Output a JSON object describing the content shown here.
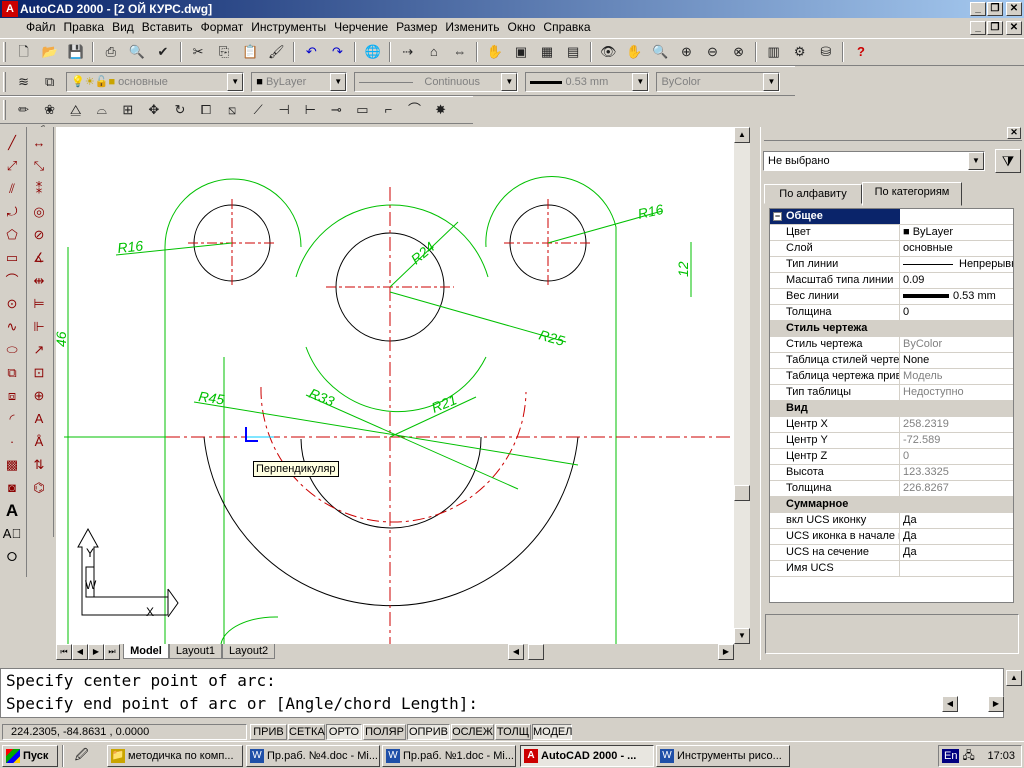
{
  "window": {
    "title": "AutoCAD 2000 - [2 ОЙ КУРС.dwg]",
    "controls": [
      "_",
      "❐",
      "✕"
    ]
  },
  "menu": [
    "Файл",
    "Правка",
    "Вид",
    "Вставить",
    "Формат",
    "Инструменты",
    "Черчение",
    "Размер",
    "Изменить",
    "Окно",
    "Справка"
  ],
  "layers_toolbar": {
    "layer": "основные",
    "color": "ByLayer",
    "linetype": "Continuous",
    "lineweight": "0.53 mm",
    "plotstyle": "ByColor"
  },
  "drawing": {
    "dimensions": [
      "R16",
      "R16",
      "R24",
      "R25",
      "R45",
      "R33",
      "R21",
      "12",
      "46"
    ],
    "tooltip": "Перпендикуляр",
    "ucs": {
      "y": "Y",
      "x": "X",
      "w": "W"
    }
  },
  "layout_tabs": [
    "Model",
    "Layout1",
    "Layout2"
  ],
  "properties": {
    "selection": "Не выбрано",
    "tabs": [
      "По алфавиту",
      "По категориям"
    ],
    "rows": [
      {
        "k": "Общее",
        "v": "",
        "cat": true,
        "sel": true
      },
      {
        "k": "Цвет",
        "v": "ByLayer",
        "swatch": true
      },
      {
        "k": "Слой",
        "v": "основные"
      },
      {
        "k": "Тип линии",
        "v": "Непрерывн",
        "line": true
      },
      {
        "k": "Масштаб типа линии",
        "v": "0.09"
      },
      {
        "k": "Вес линии",
        "v": "0.53 mm",
        "bar": true
      },
      {
        "k": "Толщина",
        "v": "0"
      },
      {
        "k": "Стиль чертежа",
        "v": "",
        "cat": true
      },
      {
        "k": "Стиль чертежа",
        "v": "ByColor",
        "grey": true
      },
      {
        "k": "Таблица стилей черте",
        "v": "None"
      },
      {
        "k": "Таблица чертежа прив",
        "v": "Модель",
        "grey": true
      },
      {
        "k": "Тип таблицы",
        "v": "Недоступно",
        "grey": true
      },
      {
        "k": "Вид",
        "v": "",
        "cat": true
      },
      {
        "k": "Центр X",
        "v": "258.2319",
        "grey": true
      },
      {
        "k": "Центр Y",
        "v": "-72.589",
        "grey": true
      },
      {
        "k": "Центр Z",
        "v": "0",
        "grey": true
      },
      {
        "k": "Высота",
        "v": "123.3325",
        "grey": true
      },
      {
        "k": "Толщина",
        "v": "226.8267",
        "grey": true
      },
      {
        "k": "Суммарное",
        "v": "",
        "cat": true
      },
      {
        "k": "вкл UCS иконку",
        "v": "Да"
      },
      {
        "k": "UCS иконка в начале к",
        "v": "Да"
      },
      {
        "k": "UCS на сечение",
        "v": "Да"
      },
      {
        "k": "Имя UCS",
        "v": ""
      }
    ]
  },
  "command": {
    "line1": "Specify center point of arc:",
    "line2": "Specify end point of arc or [Angle/chord Length]:"
  },
  "status": {
    "coords": "224.2305, -84.8631 , 0.0000",
    "modes": [
      "ПРИВ",
      "СЕТКА",
      "ОРТО",
      "ПОЛЯР",
      "ОПРИВ",
      "ОСЛЕЖ",
      "ТОЛЩ",
      "МОДЕЛ"
    ]
  },
  "taskbar": {
    "start": "Пуск",
    "items": [
      "методичка по комп...",
      "Пр.раб. №4.doc - Mi...",
      "Пр.раб. №1.doc - Mi...",
      "AutoCAD 2000 - ...",
      "Инструменты рисо..."
    ],
    "lang": "En",
    "time": "17:03"
  }
}
